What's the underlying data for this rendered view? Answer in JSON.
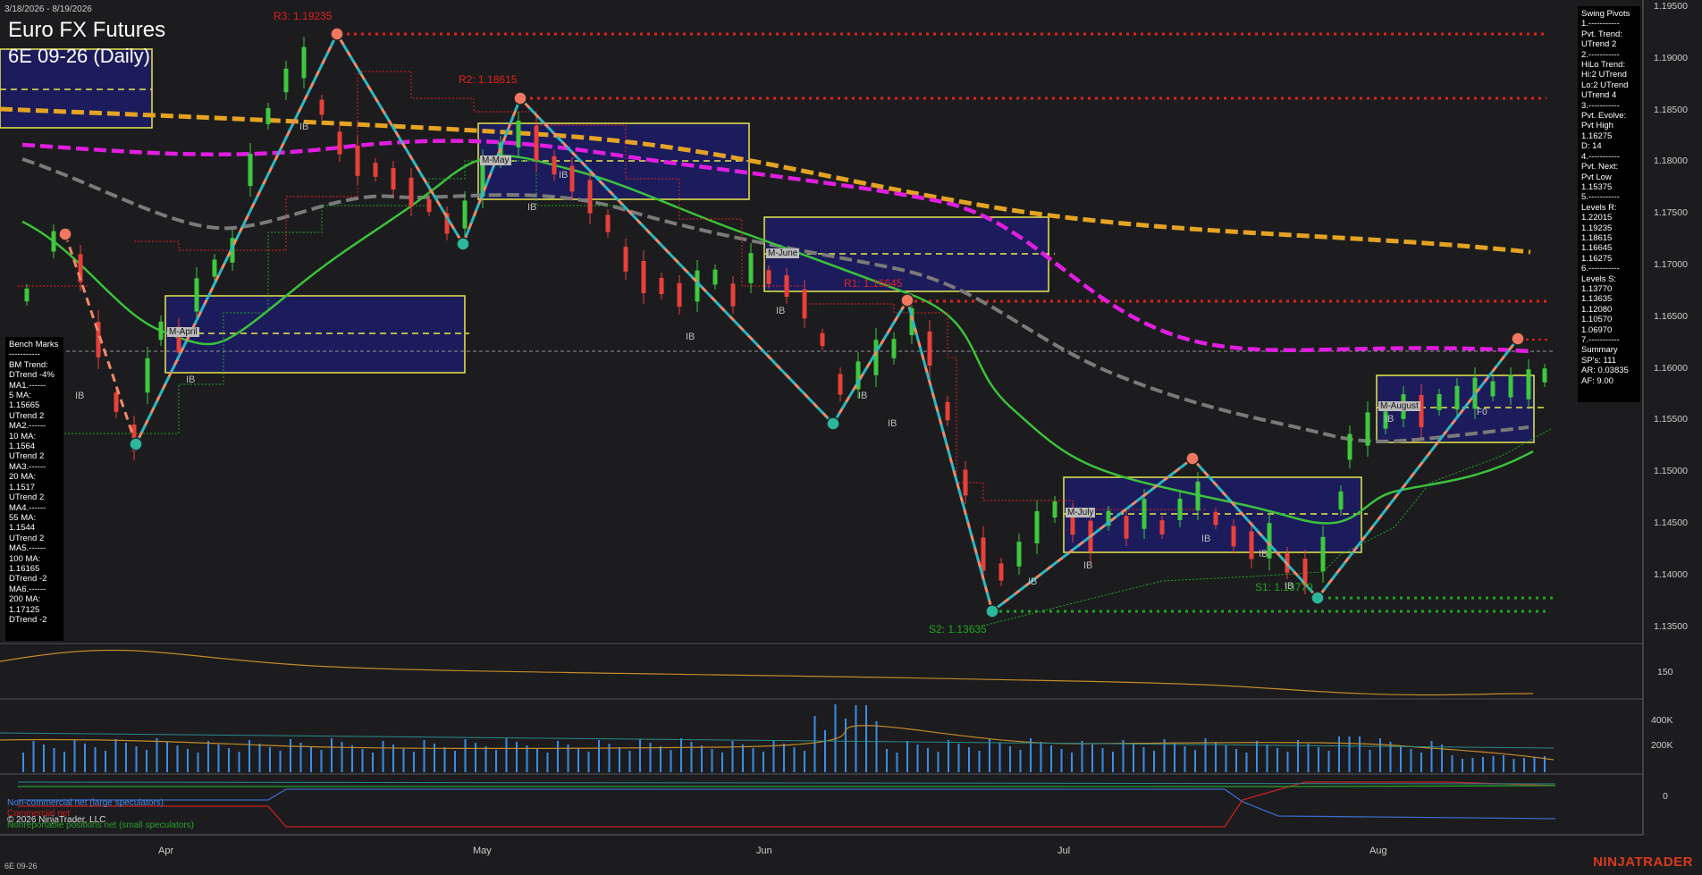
{
  "header": {
    "date_range": "3/18/2026 - 8/19/2026",
    "instrument": "Euro FX Futures",
    "contract": "6E 09-26 (Daily)"
  },
  "swing_pivots_panel": {
    "text": "Swing Pivots\n1.-----------\nPvt. Trend:\nUTrend 2\n2.-----------\nHiLo Trend:\nHi:2 UTrend\nLo:2 UTrend\nUTrend 4\n3.-----------\nPvt. Evolve:\nPvt High\n1.16275\nD: 14\n4.-----------\nPvt. Next:\nPvt Low\n1.15375\n5.-----------\nLevels R:\n1.22015\n1.19235\n1.18615\n1.16645\n1.16275\n6.-----------\nLevels S:\n1.13770\n1.13635\n1.12080\n1.10570\n1.06970\n7.-----------\nSummary\nSP's: 111\nAR: 0.03835\nAF: 9.00"
  },
  "benchmarks_panel": {
    "text": "Bench Marks\n-----------\nBM Trend:\nDTrend -4%\nMA1.------\n5 MA:\n1.15665\nUTrend 2\nMA2.------\n10 MA:\n1.1564\nUTrend 2\nMA3.------\n20 MA:\n1.1517\nUTrend 2\nMA4.------\n55 MA:\n1.1544\nUTrend 2\nMA5.------\n100 MA:\n1.16165\nDTrend -2\nMA6.------\n200 MA:\n1.17125\nDTrend -2"
  },
  "price_axis": [
    "1.19500",
    "1.19000",
    "1.18500",
    "1.18000",
    "1.17500",
    "1.17000",
    "1.16500",
    "1.16000",
    "1.15500",
    "1.15000",
    "1.14500",
    "1.14000",
    "1.13500"
  ],
  "indicator_axis": [
    "150"
  ],
  "volume_axis": [
    "400K",
    "200K"
  ],
  "cot_axis": [
    "0"
  ],
  "x_axis": [
    "Apr",
    "May",
    "Jun",
    "Jul",
    "Aug"
  ],
  "pivot_labels": {
    "r3": "R3: 1.19235",
    "r2": "R2: 1.18615",
    "r1": "R1: 1.16645",
    "s2": "S2: 1.13635",
    "s1": "S1: 1.13770"
  },
  "monthly_boxes": [
    "M-April",
    "M-May",
    "M-June",
    "M-July",
    "M-August"
  ],
  "ib_label": "IB",
  "fo_label": "F0",
  "cot_legend": {
    "large": "Non-commercial net (large speculators)",
    "commercial": "Commercial net",
    "copyright": "© 2026 NinjaTrader, LLC",
    "small": "Nonreportable positions net (small speculators)"
  },
  "footer": {
    "symbol": "6E 09-26",
    "brand": "NINJATRADER"
  },
  "colors": {
    "background": "#1c1c1e",
    "up_candle": "#3ec93e",
    "down_candle": "#e8413a",
    "ma_magenta": "#e01ee0",
    "ma_orange": "#e5a323",
    "ma_green": "#3cc13c",
    "ma_gray": "#7a7a7a",
    "box_fill": "#1c1c5c",
    "box_border": "#e8e84a",
    "resistance": "#e02020",
    "support": "#22a522",
    "swing_up": "#2bb8c0",
    "swing_down": "#f08a6a",
    "volume": "#3a8ee6",
    "brand": "#d9391d"
  }
}
